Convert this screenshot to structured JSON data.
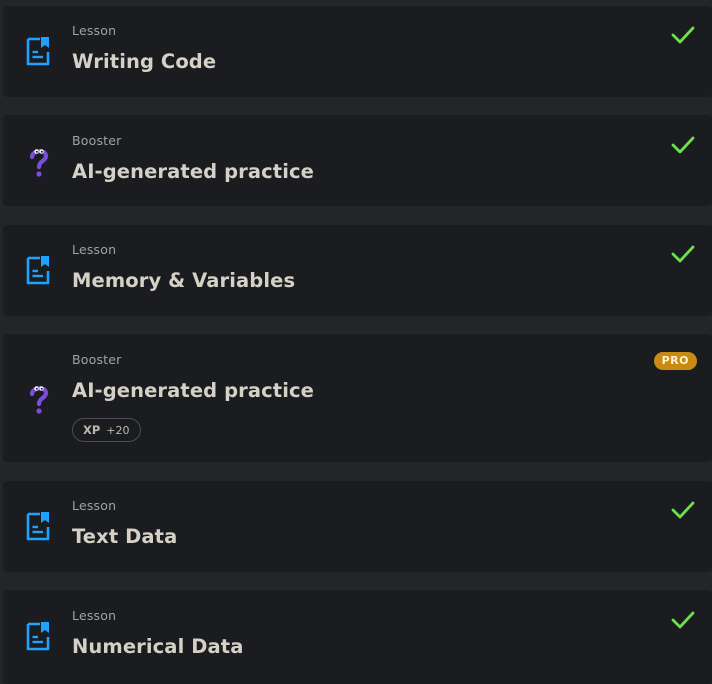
{
  "items": [
    {
      "kind": "Lesson",
      "title": "Writing Code",
      "status": "completed",
      "icon": "lesson-doc-icon"
    },
    {
      "kind": "Booster",
      "title": "AI-generated practice",
      "status": "completed",
      "icon": "question-mark-icon"
    },
    {
      "kind": "Lesson",
      "title": "Memory & Variables",
      "status": "completed",
      "icon": "lesson-doc-icon"
    },
    {
      "kind": "Booster",
      "title": "AI-generated practice",
      "status": "pro",
      "icon": "question-mark-icon",
      "badge": "PRO",
      "xp_label": "XP",
      "xp_value": "+20"
    },
    {
      "kind": "Lesson",
      "title": "Text Data",
      "status": "completed",
      "icon": "lesson-doc-icon"
    },
    {
      "kind": "Lesson",
      "title": "Numerical Data",
      "status": "completed",
      "icon": "lesson-doc-icon"
    }
  ],
  "colors": {
    "background": "#232528",
    "card": "#1a1c1f",
    "lesson_icon": "#1fa2ff",
    "booster_icon": "#7c4ddb",
    "check": "#6fe04c",
    "pro_badge": "#c98a12"
  }
}
